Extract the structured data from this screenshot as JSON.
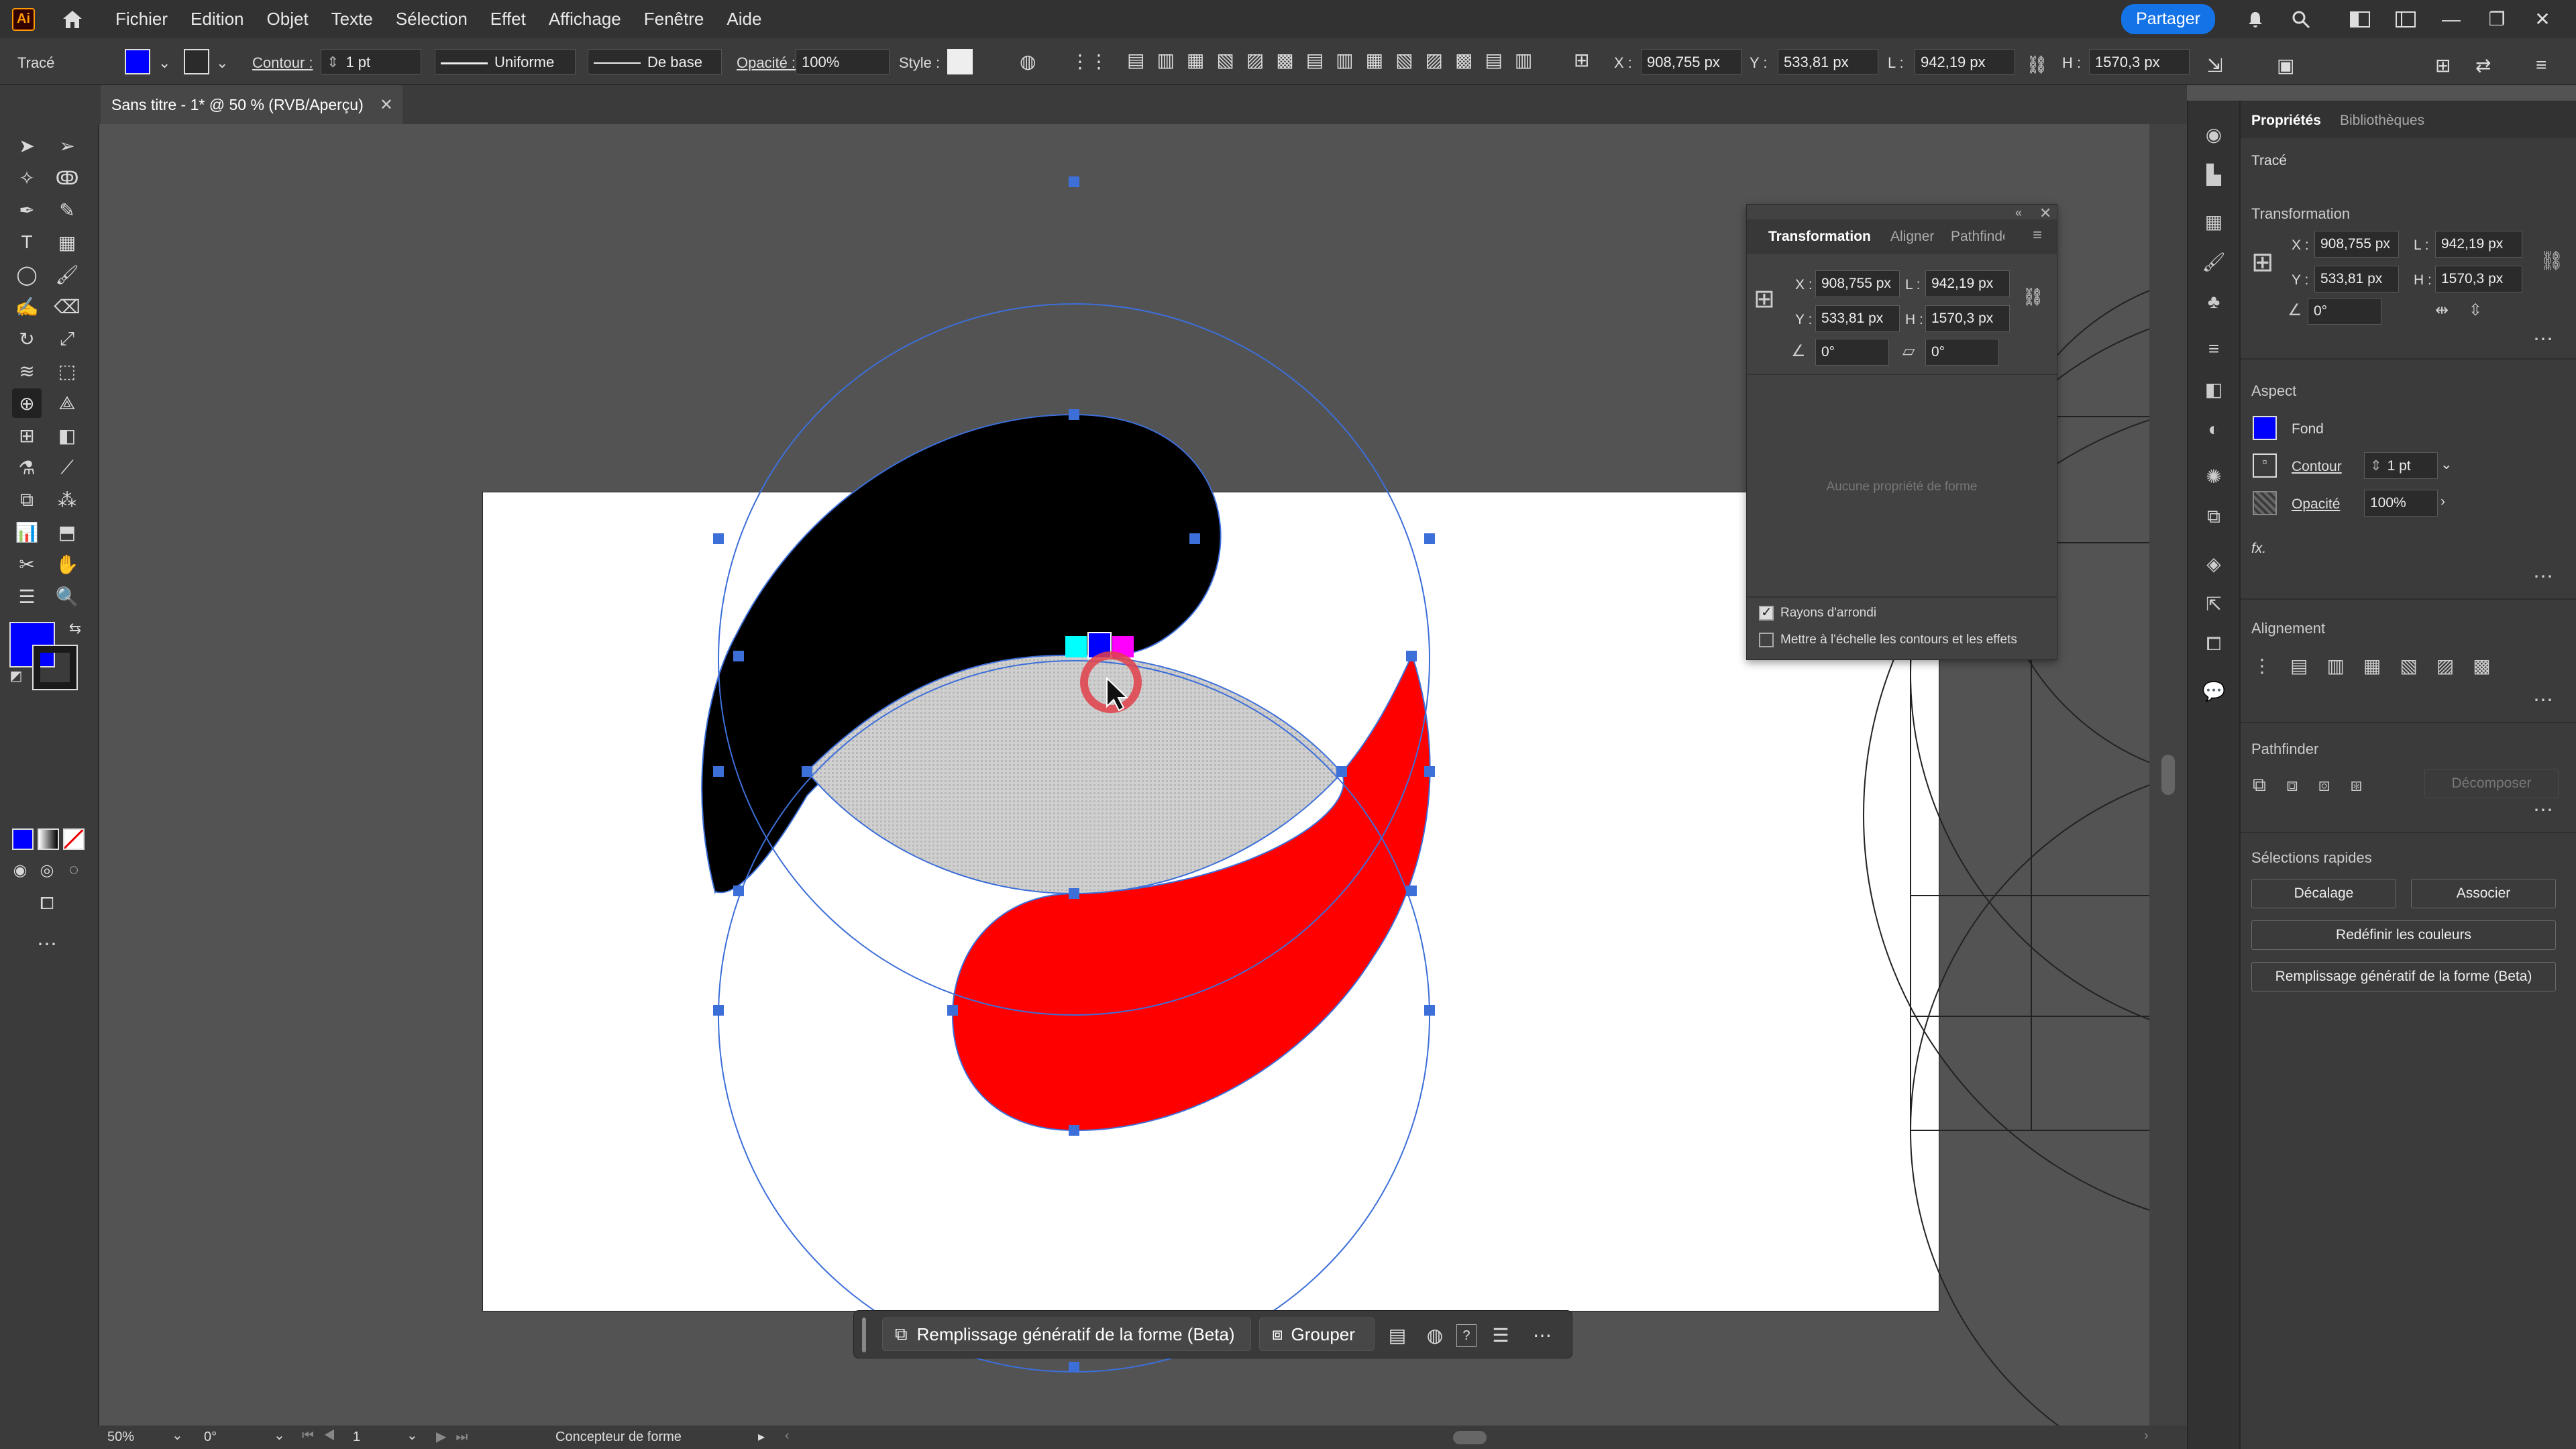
{
  "menubar": {
    "logo": "Ai",
    "items": [
      "Fichier",
      "Edition",
      "Objet",
      "Texte",
      "Sélection",
      "Effet",
      "Affichage",
      "Fenêtre",
      "Aide"
    ],
    "share": "Partager"
  },
  "control": {
    "object_type": "Tracé",
    "stroke_label": "Contour :",
    "stroke_weight": "1 pt",
    "profile": "Uniforme",
    "brush": "De base",
    "opacity_label": "Opacité :",
    "opacity": "100%",
    "style_label": "Style :",
    "x_label": "X :",
    "x": "908,755 px",
    "y_label": "Y :",
    "y": "533,81 px",
    "w_label": "L :",
    "w": "942,19 px",
    "h_label": "H :",
    "h": "1570,3 px"
  },
  "document": {
    "tab_title": "Sans titre - 1* @ 50 % (RVB/Aperçu)"
  },
  "colors": {
    "fill": "#0000ff",
    "accent": "#1473e6",
    "black_shape": "#000000",
    "red_shape": "#ff0000",
    "selection": "#3d6fd9"
  },
  "transform_panel": {
    "tabs": [
      "Transformation",
      "Aligner",
      "Pathfinder"
    ],
    "x_label": "X :",
    "x": "908,755 px",
    "y_label": "Y :",
    "y": "533,81 px",
    "w_label": "L :",
    "w": "942,19 px",
    "h_label": "H :",
    "h": "1570,3 px",
    "rotate": "0°",
    "shear": "0°",
    "empty_text": "Aucune propriété de forme",
    "option1": "Rayons d'arrondi",
    "option2": "Mettre à l'échelle les contours et les effets"
  },
  "properties": {
    "tabs": [
      "Propriétés",
      "Bibliothèques"
    ],
    "object_type": "Tracé",
    "transform_title": "Transformation",
    "x_label": "X :",
    "x": "908,755 px",
    "y_label": "Y :",
    "y": "533,81 px",
    "w_label": "L :",
    "w": "942,19 px",
    "h_label": "H :",
    "h": "1570,3 px",
    "rotate": "0°",
    "appearance_title": "Aspect",
    "fill_label": "Fond",
    "stroke_label": "Contour",
    "stroke_weight": "1 pt",
    "opacity_label": "Opacité",
    "opacity": "100%",
    "fx": "fx.",
    "align_title": "Alignement",
    "pathfinder_title": "Pathfinder",
    "decompose": "Décomposer",
    "quick_title": "Sélections rapides",
    "btn_offset": "Décalage",
    "btn_join": "Associer",
    "btn_recolor": "Redéfinir les couleurs",
    "btn_genfill": "Remplissage génératif de la forme (Beta)"
  },
  "context_bar": {
    "genfill": "Remplissage génératif de la forme (Beta)",
    "group": "Grouper"
  },
  "status": {
    "zoom": "50%",
    "rotation": "0°",
    "artboard": "1",
    "tool": "Concepteur de forme"
  }
}
